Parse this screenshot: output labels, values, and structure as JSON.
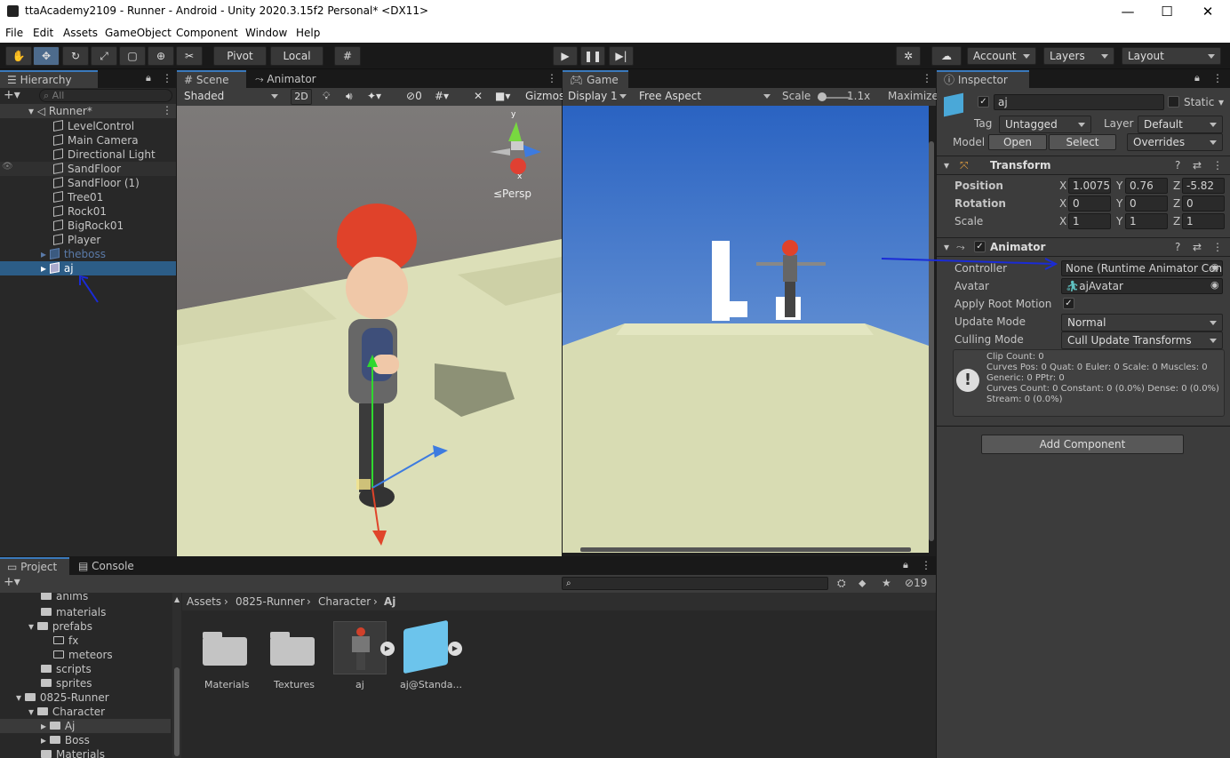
{
  "window": {
    "title": "ttaAcademy2109 - Runner - Android - Unity 2020.3.15f2 Personal* <DX11>",
    "minimize": "—",
    "maximize": "☐",
    "close": "✕"
  },
  "menu": [
    "File",
    "Edit",
    "Assets",
    "GameObject",
    "Component",
    "Window",
    "Help"
  ],
  "toolbar": {
    "pivot": "Pivot",
    "local": "Local",
    "account": "Account",
    "layers": "Layers",
    "layout": "Layout"
  },
  "hierarchy": {
    "tab": "Hierarchy",
    "search_placeholder": "All",
    "scene": "Runner*",
    "items": [
      "LevelControl",
      "Main Camera",
      "Directional Light",
      "SandFloor",
      "SandFloor (1)",
      "Tree01",
      "Rock01",
      "BigRock01",
      "Player",
      "theboss",
      "aj"
    ]
  },
  "scene": {
    "tab": "Scene",
    "tab2": "Animator",
    "shading": "Shaded",
    "mode2d": "2D",
    "gizmo_count": "0",
    "gizmos": "Gizmos",
    "persp": "≤Persp",
    "axis_y": "y",
    "axis_x": "x"
  },
  "game": {
    "tab": "Game",
    "display": "Display 1",
    "aspect": "Free Aspect",
    "scale_label": "Scale",
    "scale_value": "1.1x",
    "maximize": "Maximize"
  },
  "inspector": {
    "tab": "Inspector",
    "name": "aj",
    "static": "Static",
    "tag_label": "Tag",
    "tag": "Untagged",
    "layer_label": "Layer",
    "layer": "Default",
    "model_label": "Model",
    "open": "Open",
    "select": "Select",
    "overrides": "Overrides",
    "transform": {
      "title": "Transform",
      "position_label": "Position",
      "rotation_label": "Rotation",
      "scale_label": "Scale",
      "pos": {
        "x": "1.0075",
        "y": "0.76",
        "z": "-5.82"
      },
      "rot": {
        "x": "0",
        "y": "0",
        "z": "0"
      },
      "scl": {
        "x": "1",
        "y": "1",
        "z": "1"
      }
    },
    "animator": {
      "title": "Animator",
      "controller_label": "Controller",
      "controller": "None (Runtime Animator Con",
      "avatar_label": "Avatar",
      "avatar": "ajAvatar",
      "root_motion_label": "Apply Root Motion",
      "update_mode_label": "Update Mode",
      "update_mode": "Normal",
      "culling_label": "Culling Mode",
      "culling": "Cull Update Transforms",
      "info": [
        "Clip Count: 0",
        "Curves Pos: 0 Quat: 0 Euler: 0 Scale: 0 Muscles: 0",
        "Generic: 0 PPtr: 0",
        "Curves Count: 0 Constant: 0 (0.0%) Dense: 0 (0.0%)",
        "Stream: 0 (0.0%)"
      ]
    },
    "add_component": "Add Component"
  },
  "project": {
    "tab": "Project",
    "tab2": "Console",
    "badge": "19",
    "tree": [
      "anims",
      "materials",
      "prefabs",
      "fx",
      "meteors",
      "scripts",
      "sprites",
      "0825-Runner",
      "Character",
      "Aj",
      "Boss",
      "Materials"
    ],
    "breadcrumb": [
      "Assets",
      "0825-Runner",
      "Character",
      "Aj"
    ],
    "assets": [
      "Materials",
      "Textures",
      "aj",
      "aj@Standa..."
    ]
  }
}
